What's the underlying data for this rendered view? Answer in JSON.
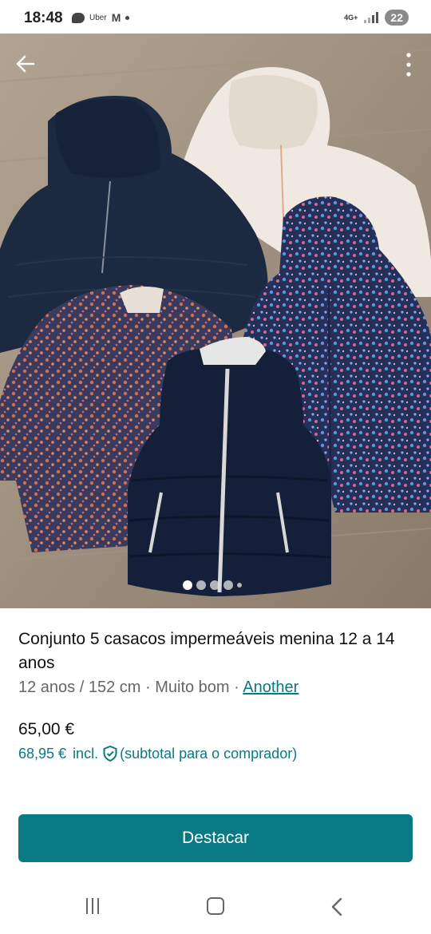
{
  "status_bar": {
    "time": "18:48",
    "uber_label": "Uber",
    "gmail_label": "M",
    "network": "4G+",
    "battery": "22"
  },
  "listing": {
    "photo_alt": "Conjunto 5 casacos",
    "image_count": 5,
    "active_image_index": 0,
    "title": "Conjunto 5 casacos impermeáveis menina 12 a 14 anos",
    "size": "12 anos / 152 cm",
    "separator": " · ",
    "condition": "Muito bom",
    "brand": "Another",
    "price": "65,00 €",
    "price_incl": "68,95 €",
    "incl_label": "incl.",
    "incl_note": "(subtotal para o comprador)",
    "cta_label": "Destacar"
  },
  "colors": {
    "accent": "#097a84",
    "link": "#0a7a82"
  },
  "icons": {
    "back": "arrow-left-icon",
    "more": "more-vertical-icon",
    "shield": "shield-check-icon"
  }
}
